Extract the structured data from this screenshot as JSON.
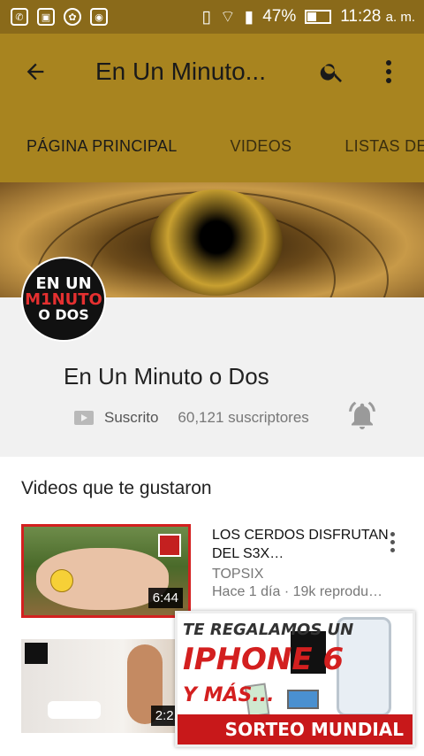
{
  "status_bar": {
    "battery": "47%",
    "battery_level": 0.47,
    "time": "11:28",
    "ampm": "a. m."
  },
  "app_bar": {
    "title": "En Un Minuto...",
    "tabs": [
      "PÁGINA PRINCIPAL",
      "VIDEOS",
      "LISTAS DE RE"
    ],
    "active_tab": 0,
    "accent": "#a8841f"
  },
  "channel": {
    "name": "En Un Minuto o Dos",
    "avatar_text": {
      "l1": "EN UN",
      "l2": "M1NUTO",
      "l3": "O DOS"
    },
    "subscribed_label": "Suscrito",
    "subscribers": "60,121 suscriptores"
  },
  "section": {
    "title": "Videos que te gustaron"
  },
  "videos": [
    {
      "title": "LOS CERDOS DISFRUTAN DEL S3X…",
      "channel": "TOPSIX",
      "info": "Hace 1 día · 19k reproduc…",
      "duration": "6:44"
    },
    {
      "title": "",
      "channel": "",
      "info": "",
      "duration": "2:21"
    }
  ],
  "ad": {
    "line1": "TE REGALAMOS UN",
    "line2": "IPHONE 6",
    "line3": "Y MÁS...",
    "footer": "SORTEO MUNDIAL"
  }
}
